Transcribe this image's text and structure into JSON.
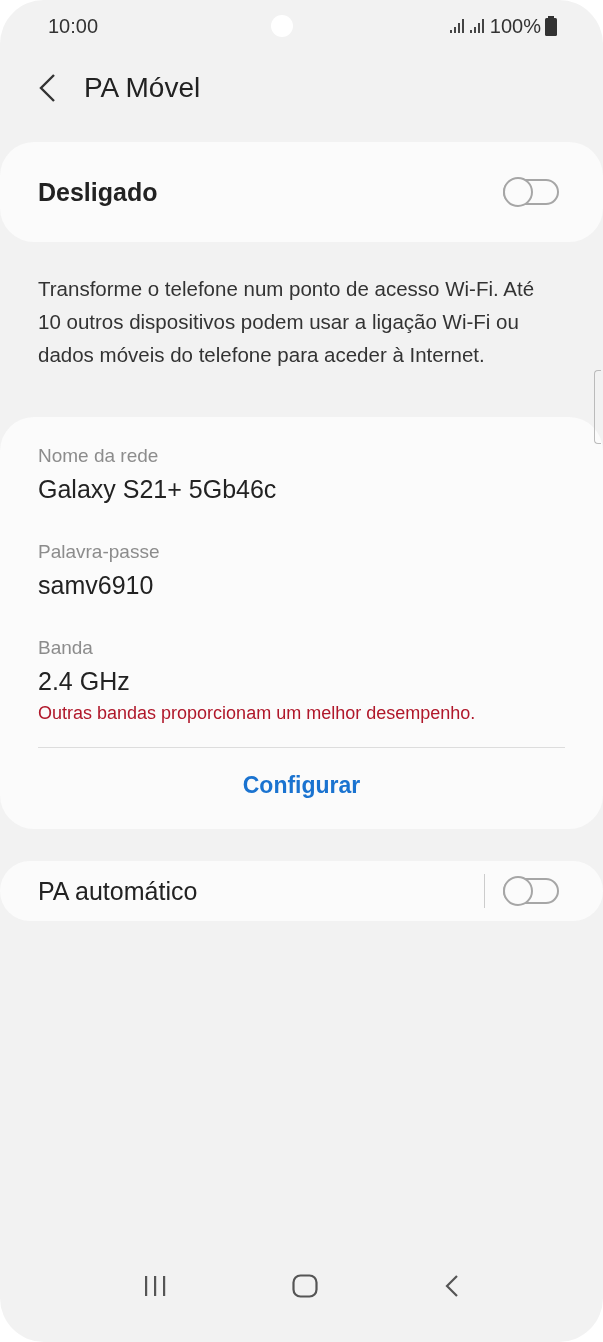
{
  "status_bar": {
    "time": "10:00",
    "battery": "100%"
  },
  "header": {
    "title": "PA Móvel"
  },
  "main_switch": {
    "label": "Desligado",
    "on": false
  },
  "description": "Transforme o telefone num ponto de acesso Wi-Fi. Até 10 outros dispositivos podem usar a ligação Wi-Fi ou dados móveis do telefone para aceder à Internet.",
  "settings": [
    {
      "label": "Nome da rede",
      "value": "Galaxy S21+ 5Gb46c"
    },
    {
      "label": "Palavra-passe",
      "value": "samv6910"
    },
    {
      "label": "Banda",
      "value": "2.4 GHz",
      "warning": "Outras bandas proporcionam um melhor desempenho."
    }
  ],
  "configure_button": "Configurar",
  "auto_switch": {
    "label": "PA automático",
    "on": false
  }
}
